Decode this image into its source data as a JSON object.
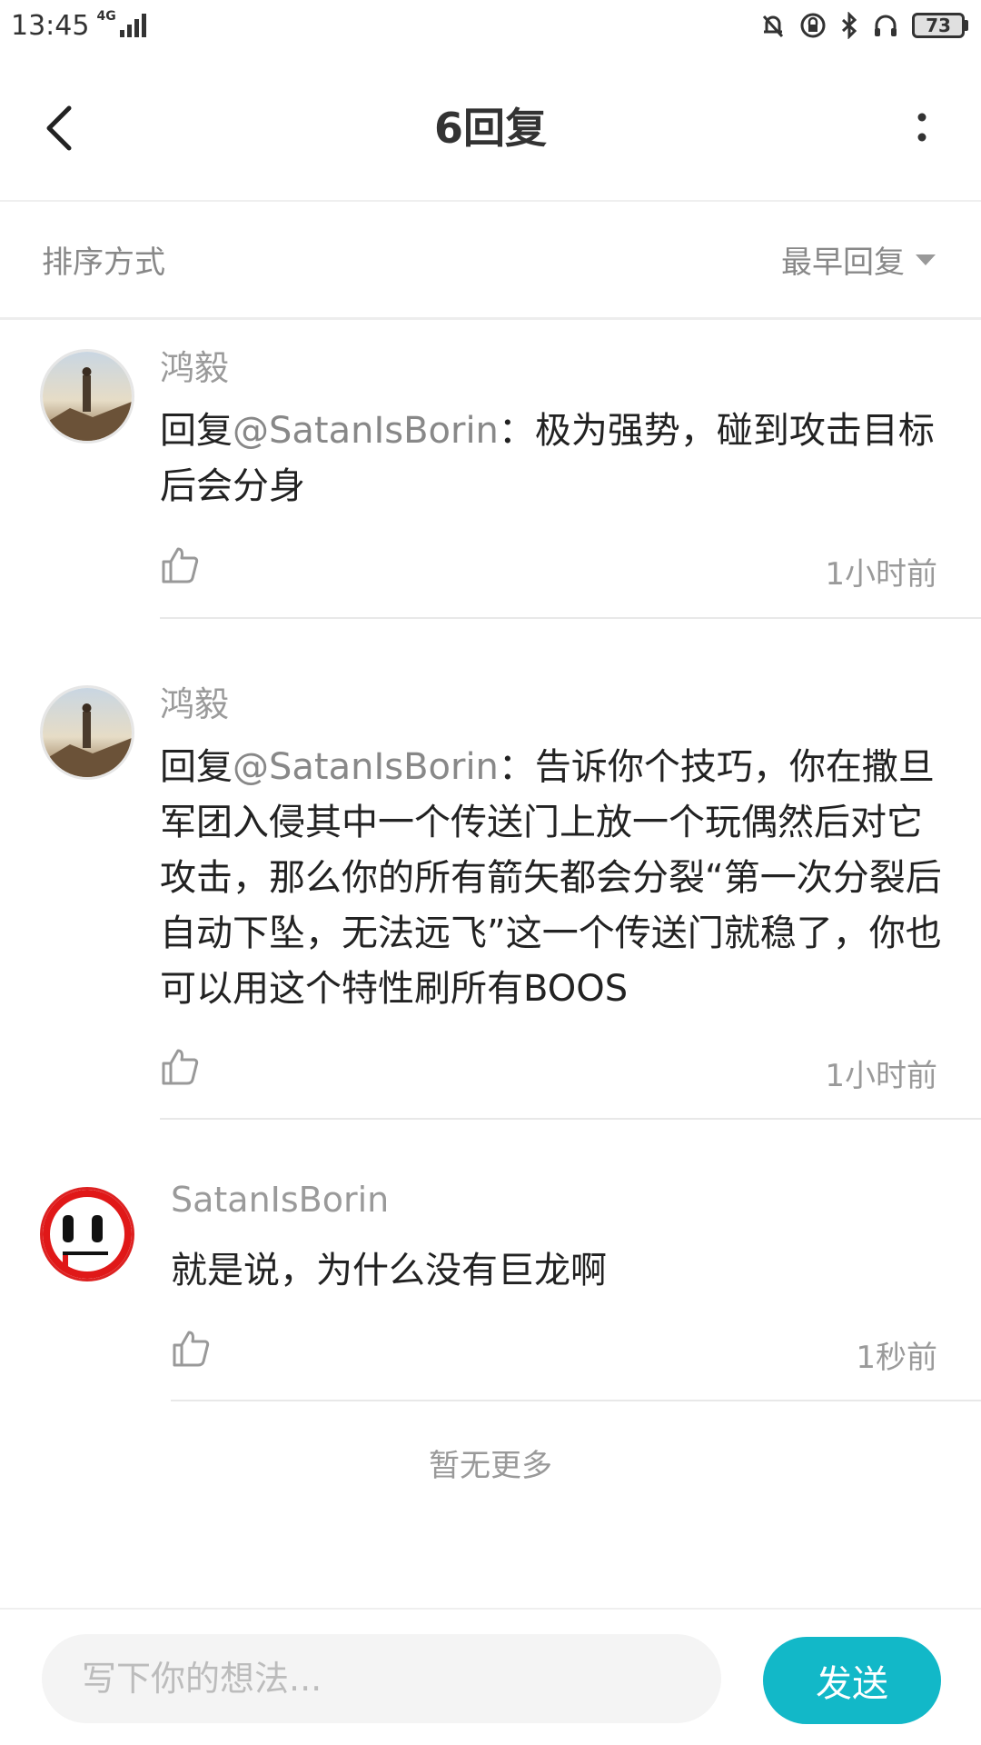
{
  "status_bar": {
    "time": "13:45",
    "network": "4G",
    "battery": "73"
  },
  "header": {
    "title": "6回复"
  },
  "sort": {
    "label": "排序方式",
    "selected": "最早回复"
  },
  "replies": [
    {
      "author": "鸿毅",
      "prefix": "回复",
      "mention": "@SatanIsBorin",
      "text": "：极为强势，碰到攻击目标后会分身",
      "time": "1小时前"
    },
    {
      "author": "鸿毅",
      "prefix": "回复",
      "mention": "@SatanIsBorin",
      "text": "：告诉你个技巧，你在撒旦军团入侵其中一个传送门上放一个玩偶然后对它攻击，那么你的所有箭矢都会分裂“第一次分裂后自动下坠，无法远飞”这一个传送门就稳了，你也可以用这个特性刷所有BOOS",
      "time": "1小时前"
    },
    {
      "author": "SatanIsBorin",
      "text": "就是说，为什么没有巨龙啊",
      "time": "1秒前"
    }
  ],
  "footer": {
    "no_more": "暂无更多"
  },
  "composer": {
    "placeholder": "写下你的想法...",
    "send_label": "发送"
  },
  "colors": {
    "accent": "#12b8c8",
    "muted_text": "#9a9a9a"
  }
}
